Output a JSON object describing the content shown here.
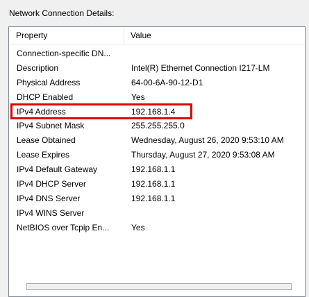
{
  "section_label": "Network Connection Details:",
  "columns": {
    "property": "Property",
    "value": "Value"
  },
  "rows": [
    {
      "property": "Connection-specific DN...",
      "value": ""
    },
    {
      "property": "Description",
      "value": "Intel(R) Ethernet Connection I217-LM"
    },
    {
      "property": "Physical Address",
      "value": "64-00-6A-90-12-D1"
    },
    {
      "property": "DHCP Enabled",
      "value": "Yes"
    },
    {
      "property": "IPv4 Address",
      "value": "192.168.1.4"
    },
    {
      "property": "IPv4 Subnet Mask",
      "value": "255.255.255.0"
    },
    {
      "property": "Lease Obtained",
      "value": "Wednesday, August 26, 2020 9:53:10 AM"
    },
    {
      "property": "Lease Expires",
      "value": "Thursday, August 27, 2020 9:53:08 AM"
    },
    {
      "property": "IPv4 Default Gateway",
      "value": "192.168.1.1"
    },
    {
      "property": "IPv4 DHCP Server",
      "value": "192.168.1.1"
    },
    {
      "property": "IPv4 DNS Server",
      "value": "192.168.1.1"
    },
    {
      "property": "IPv4 WINS Server",
      "value": ""
    },
    {
      "property": "NetBIOS over Tcpip En...",
      "value": "Yes"
    }
  ],
  "highlighted_row": "IPv4 Address",
  "colors": {
    "highlight": "#e00000",
    "border": "#828790",
    "background": "#f0f0f0"
  }
}
